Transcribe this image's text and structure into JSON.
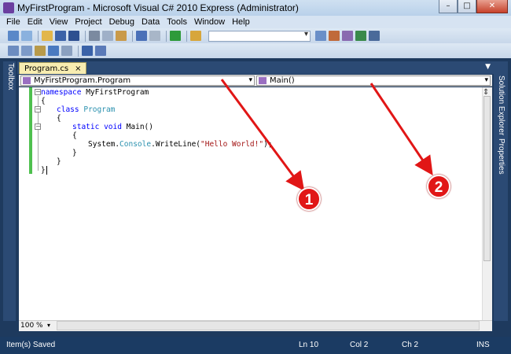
{
  "window": {
    "title": "MyFirstProgram - Microsoft Visual C# 2010 Express (Administrator)"
  },
  "menu": [
    "File",
    "Edit",
    "View",
    "Project",
    "Debug",
    "Data",
    "Tools",
    "Window",
    "Help"
  ],
  "side": {
    "toolbox": "Toolbox",
    "solution_explorer": "Solution Explorer",
    "properties": "Properties"
  },
  "doc_tab": {
    "label": "Program.cs",
    "close": "×"
  },
  "nav": {
    "type_combo": "MyFirstProgram.Program",
    "member_combo": "Main()"
  },
  "code": {
    "l1": [
      "namespace",
      " MyFirstProgram"
    ],
    "l2": "{",
    "l3": [
      "class",
      " ",
      "Program"
    ],
    "l4": "{",
    "l5": [
      "static",
      " ",
      "void",
      " Main()"
    ],
    "l6": "{",
    "l7": [
      "System.",
      "Console",
      ".WriteLine(",
      "\"Hello World!\"",
      ");"
    ],
    "l8": "}",
    "l9": "}",
    "l10": "}"
  },
  "zoom": "100 %",
  "status": {
    "message": "Item(s) Saved",
    "ln": "Ln 10",
    "col": "Col 2",
    "ch": "Ch 2",
    "mode": "INS"
  },
  "annotations": [
    "1",
    "2"
  ],
  "colors": {
    "arrow": "#e11616",
    "status_bg": "#1b3b63",
    "tab_active": "#f8edb1"
  }
}
